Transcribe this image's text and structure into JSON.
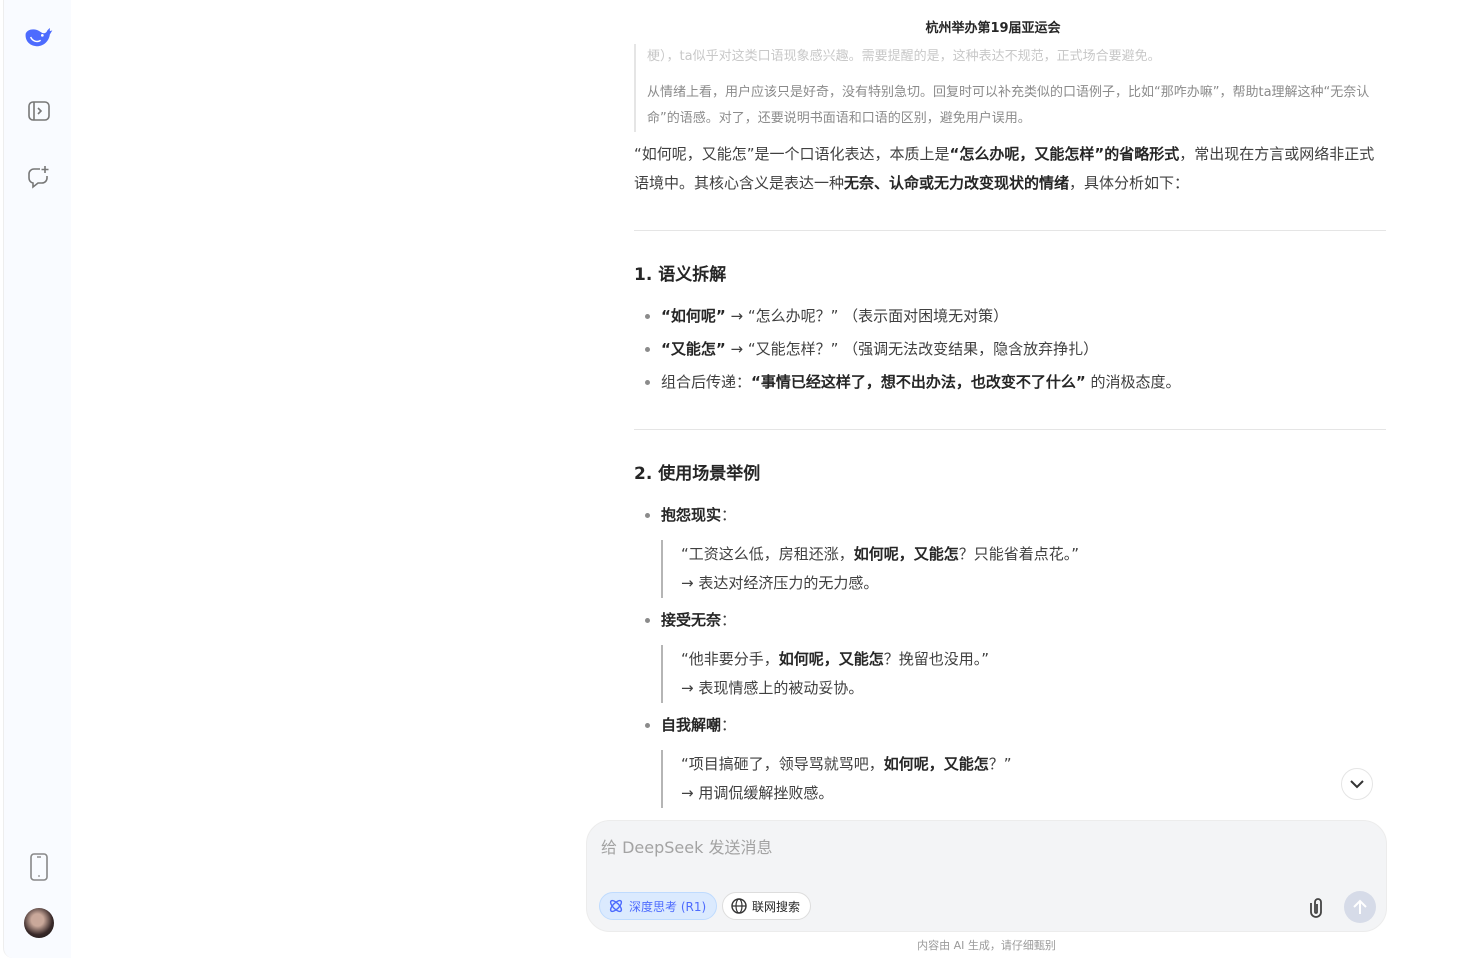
{
  "sidebar": {
    "icons": [
      "deepseek-logo",
      "sidebar-toggle-icon",
      "new-chat-icon",
      "mobile-app-icon",
      "avatar"
    ]
  },
  "header": {
    "title": "杭州举办第19届亚运会"
  },
  "thinking": {
    "faded_line": "梗），ta似乎对这类口语现象感兴趣。需要提醒的是，这种表达不规范，正式场合要避免。",
    "paragraph": "从情绪上看，用户应该只是好奇，没有特别急切。回复时可以补充类似的口语例子，比如“那咋办嘛”，帮助ta理解这种“无奈认命”的语感。对了，还要说明书面语和口语的区别，避免用户误用。"
  },
  "answer": {
    "intro": [
      {
        "t": "“如何呢，又能怎”是一个口语化表达，本质上是"
      },
      {
        "t": "“怎么办呢，又能怎样”的省略形式",
        "b": true
      },
      {
        "t": "，常出现在方言或网络非正式语境中。其核心含义是表达一种"
      },
      {
        "t": "无奈、认命或无力改变现状的情绪",
        "b": true
      },
      {
        "t": "，具体分析如下："
      }
    ],
    "section1": {
      "heading": "1. 语义拆解",
      "items": [
        [
          {
            "t": "“如何呢”",
            "b": true
          },
          {
            "t": " → “怎么办呢？” （表示面对困境无对策）"
          }
        ],
        [
          {
            "t": "“又能怎”",
            "b": true
          },
          {
            "t": " → “又能怎样？” （强调无法改变结果，隐含放弃挣扎）"
          }
        ],
        [
          {
            "t": "组合后传递："
          },
          {
            "t": "“事情已经这样了，想不出办法，也改变不了什么”",
            "b": true
          },
          {
            "t": " 的消极态度。"
          }
        ]
      ]
    },
    "section2": {
      "heading": "2. 使用场景举例",
      "items": [
        {
          "label": "抱怨现实",
          "quote": [
            {
              "t": "“工资这么低，房租还涨，"
            },
            {
              "t": "如何呢，又能怎",
              "b": true
            },
            {
              "t": "？只能省着点花。”"
            }
          ],
          "note": "→ 表达对经济压力的无力感。"
        },
        {
          "label": "接受无奈",
          "quote": [
            {
              "t": "“他非要分手，"
            },
            {
              "t": "如何呢，又能怎",
              "b": true
            },
            {
              "t": "？挽留也没用。”"
            }
          ],
          "note": "→ 表现情感上的被动妥协。"
        },
        {
          "label": "自我解嘲",
          "quote": [
            {
              "t": "“项目搞砸了，领导骂就骂吧，"
            },
            {
              "t": "如何呢，又能怎",
              "b": true
            },
            {
              "t": "？”"
            }
          ],
          "note": "→ 用调侃缓解挫败感。"
        }
      ]
    }
  },
  "input": {
    "placeholder": "给 DeepSeek 发送消息",
    "deep_think_label": "深度思考 (R1)",
    "web_search_label": "联网搜索",
    "deep_think_active": true
  },
  "footer": {
    "disclaimer": "内容由 AI 生成，请仔细甄别"
  },
  "colors": {
    "accent": "#4d6bfe",
    "sidebar_bg": "#f9fbff",
    "input_bg": "#f3f4f6"
  }
}
